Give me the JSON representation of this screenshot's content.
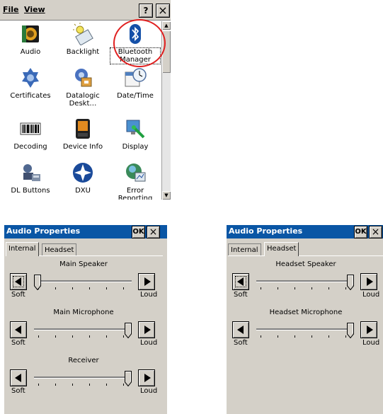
{
  "control_panel": {
    "menu": {
      "file": "File",
      "view": "View"
    },
    "help_label": "?",
    "close_label": "×",
    "items": [
      {
        "label": "Audio",
        "icon": "speaker-icon"
      },
      {
        "label": "Backlight",
        "icon": "bulb-icon"
      },
      {
        "label": "Bluetooth Manager",
        "icon": "bluetooth-icon"
      },
      {
        "label": "Certificates",
        "icon": "certificate-icon"
      },
      {
        "label": "Datalogic Deskt…",
        "icon": "desktop-icon"
      },
      {
        "label": "Date/Time",
        "icon": "clock-icon"
      },
      {
        "label": "Decoding",
        "icon": "barcode-icon"
      },
      {
        "label": "Device Info",
        "icon": "device-icon"
      },
      {
        "label": "Display",
        "icon": "monitor-icon"
      },
      {
        "label": "DL Buttons",
        "icon": "buttons-icon"
      },
      {
        "label": "DXU",
        "icon": "dxu-icon"
      },
      {
        "label": "Error Reporting",
        "icon": "error-report-icon"
      }
    ]
  },
  "audio_internal": {
    "title": "Audio Properties",
    "ok": "OK",
    "close": "×",
    "tabs": {
      "internal": "Internal",
      "headset": "Headset"
    },
    "active_tab": "Internal",
    "sliders": [
      {
        "name": "Main Speaker",
        "soft": "Soft",
        "loud": "Loud",
        "level": 0.0
      },
      {
        "name": "Main Microphone",
        "soft": "Soft",
        "loud": "Loud",
        "level": 1.0
      },
      {
        "name": "Receiver",
        "soft": "Soft",
        "loud": "Loud",
        "level": 1.0
      }
    ]
  },
  "audio_headset": {
    "title": "Audio Properties",
    "ok": "OK",
    "close": "×",
    "tabs": {
      "internal": "Internal",
      "headset": "Headset"
    },
    "active_tab": "Headset",
    "sliders": [
      {
        "name": "Headset Speaker",
        "soft": "Soft",
        "loud": "Loud",
        "level": 1.0
      },
      {
        "name": "Headset Microphone",
        "soft": "Soft",
        "loud": "Loud",
        "level": 1.0
      }
    ]
  }
}
